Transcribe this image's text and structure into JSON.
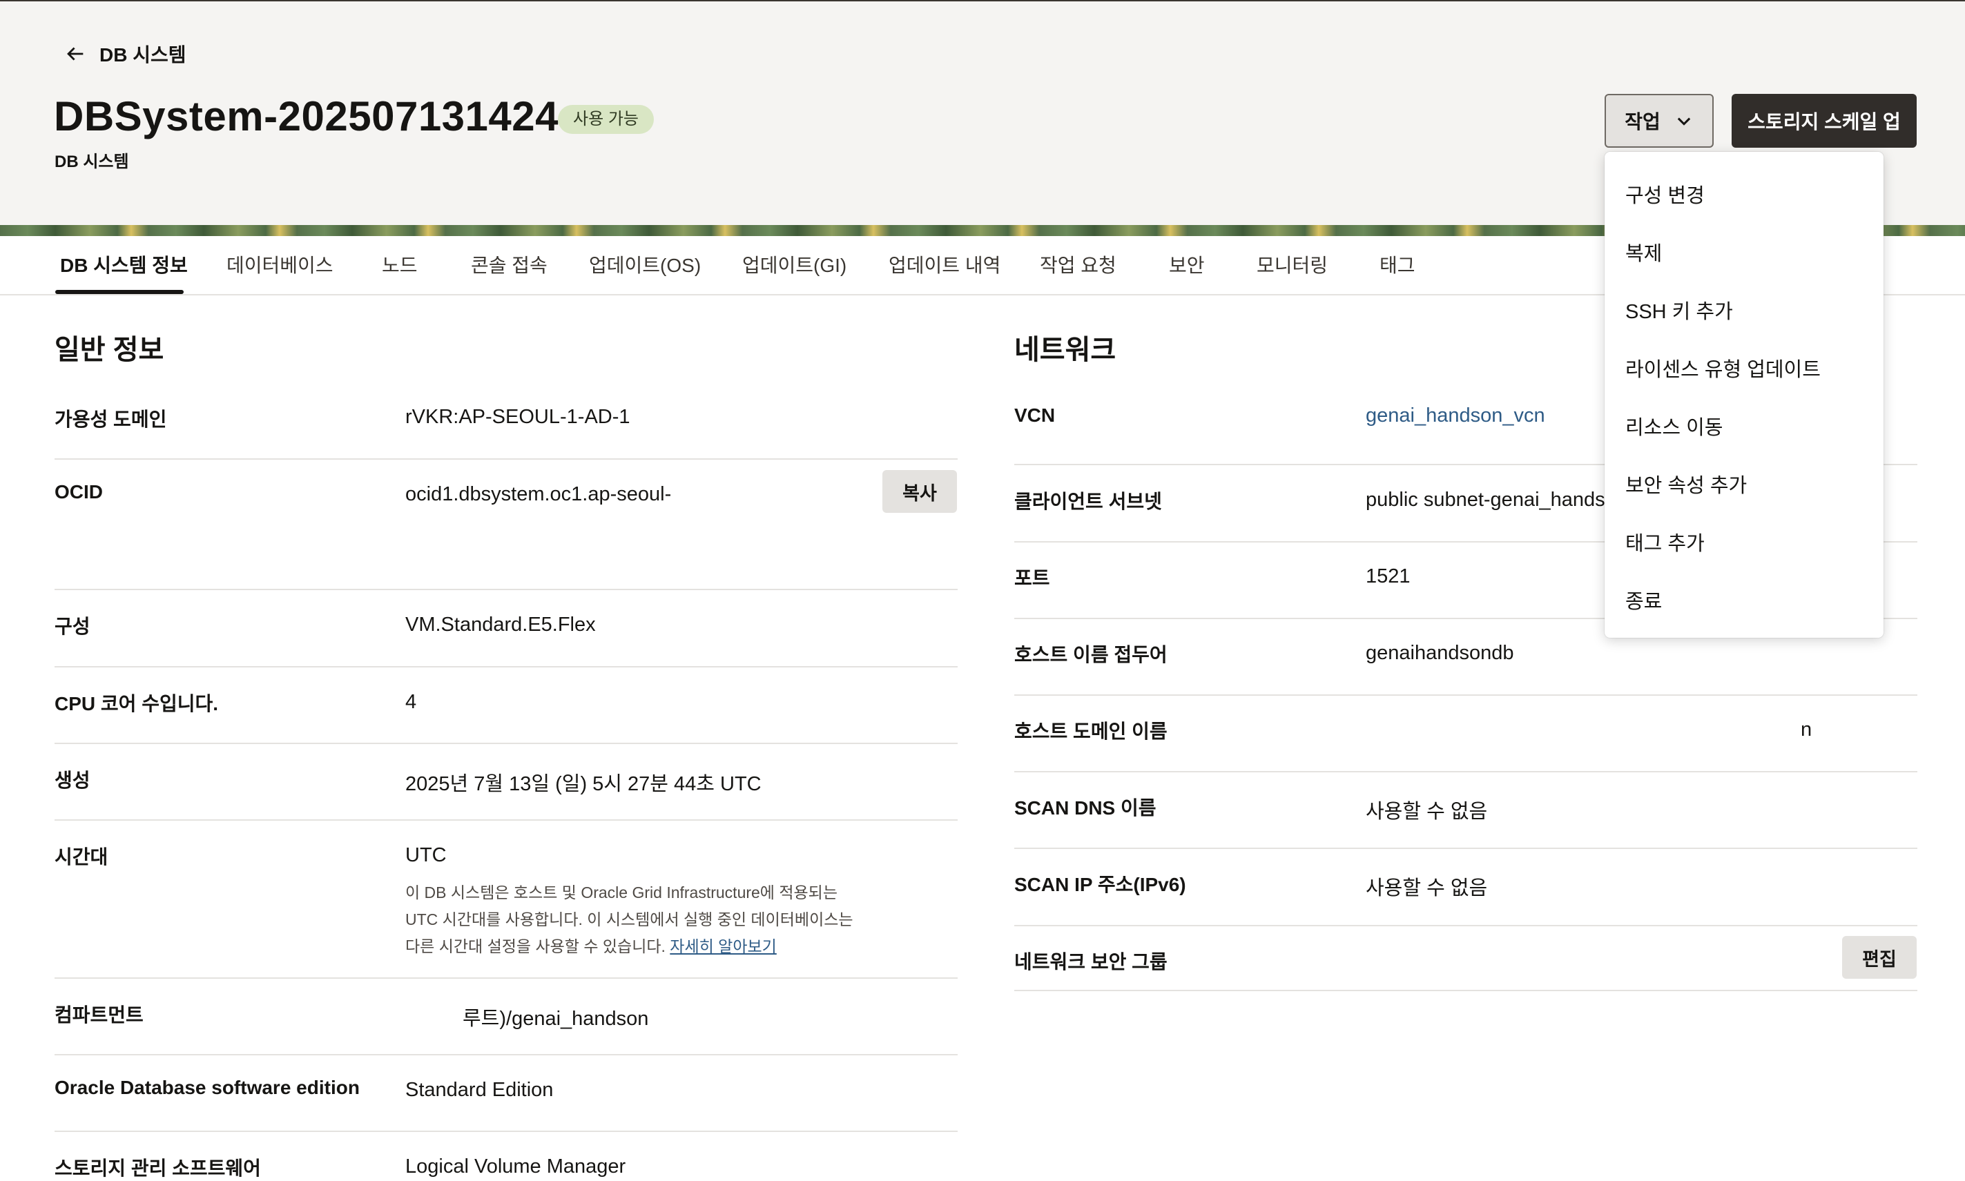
{
  "header": {
    "back_label": "DB 시스템",
    "title": "DBSystem-202507131424",
    "status": "사용 가능",
    "subtitle": "DB 시스템",
    "actions_label": "작업",
    "scale_label": "스토리지 스케일 업"
  },
  "tabs": [
    {
      "label": "DB 시스템 정보",
      "active": true
    },
    {
      "label": "데이터베이스"
    },
    {
      "label": "노드"
    },
    {
      "label": "콘솔 접속"
    },
    {
      "label": "업데이트(OS)"
    },
    {
      "label": "업데이트(GI)"
    },
    {
      "label": "업데이트 내역"
    },
    {
      "label": "작업 요청"
    },
    {
      "label": "보안"
    },
    {
      "label": "모니터링"
    },
    {
      "label": "태그"
    }
  ],
  "general": {
    "title": "일반 정보",
    "rows": [
      {
        "label": "가용성 도메인",
        "value": "rVKR:AP-SEOUL-1-AD-1"
      },
      {
        "label": "OCID",
        "value": "ocid1.dbsystem.oc1.ap-seoul-",
        "action": "복사"
      },
      {
        "label": "구성",
        "value": "VM.Standard.E5.Flex"
      },
      {
        "label": "CPU 코어 수입니다.",
        "value": "4"
      },
      {
        "label": "생성",
        "value": "2025년 7월 13일 (일) 5시 27분 44초 UTC"
      },
      {
        "label": "시간대",
        "value": "UTC"
      },
      {
        "label": "컴파트먼트",
        "value": "루트)/genai_handson"
      },
      {
        "label": "Oracle Database software edition",
        "value": "Standard Edition"
      },
      {
        "label": "스토리지 관리 소프트웨어",
        "value": "Logical Volume Manager"
      }
    ],
    "timezone_note": "이 DB 시스템은 호스트 및 Oracle Grid Infrastructure에 적용되는 UTC 시간대를 사용합니다. 이 시스템에서 실행 중인 데이터베이스는 다른 시간대 설정을 사용할 수 있습니다.",
    "timezone_link": "자세히 알아보기"
  },
  "network": {
    "title": "네트워크",
    "rows": [
      {
        "label": "VCN",
        "value": "genai_handson_vcn"
      },
      {
        "label": "클라이언트 서브넷",
        "value": "public subnet-genai_hands"
      },
      {
        "label": "포트",
        "value": "1521"
      },
      {
        "label": "호스트 이름 접두어",
        "value": "genaihandsondb"
      },
      {
        "label": "호스트 도메인 이름",
        "value": "n"
      },
      {
        "label": "SCAN DNS 이름",
        "value": "사용할 수 없음"
      },
      {
        "label": "SCAN IP 주소(IPv6)",
        "value": "사용할 수 없음"
      },
      {
        "label": "네트워크 보안 그룹",
        "value": "",
        "action": "편집"
      }
    ]
  },
  "actions_menu": {
    "items": [
      "구성 변경",
      "복제",
      "SSH 키 추가",
      "라이센스 유형 업데이트",
      "리소스 이동",
      "보안 속성 추가",
      "태그 추가",
      "종료"
    ]
  }
}
